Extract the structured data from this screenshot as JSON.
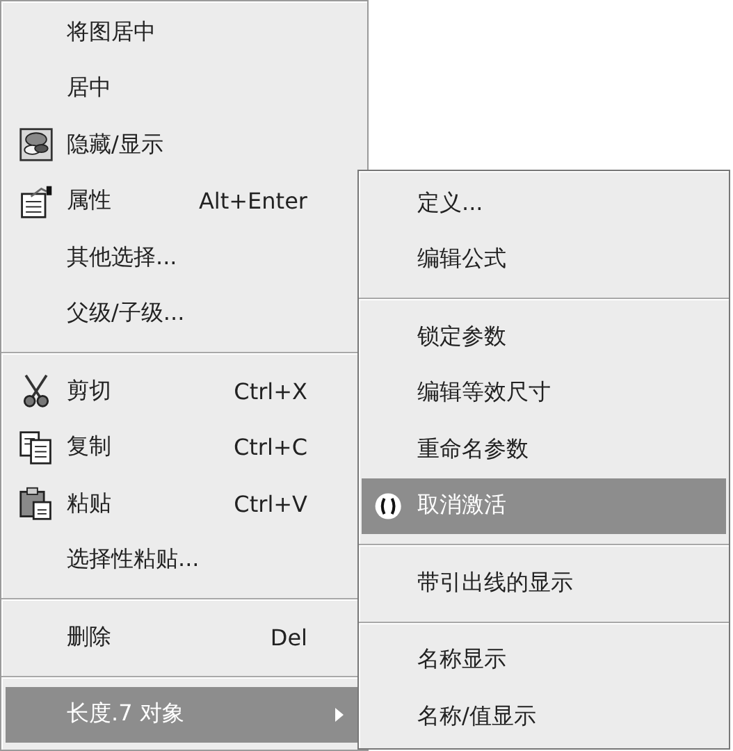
{
  "context_menu": {
    "items": [
      {
        "kind": "command",
        "label": "将图居中",
        "selected": false
      },
      {
        "kind": "command",
        "label": "居中",
        "selected": false
      },
      {
        "kind": "command",
        "label": "隐藏/显示",
        "selected": false
      },
      {
        "kind": "command",
        "label": "属性",
        "shortcut": "Alt+Enter",
        "selected": false
      },
      {
        "kind": "command",
        "label": "其他选择...",
        "selected": false
      },
      {
        "kind": "command",
        "label": "父级/子级...",
        "selected": false
      },
      {
        "kind": "separator"
      },
      {
        "kind": "command",
        "label": "剪切",
        "shortcut": "Ctrl+X",
        "selected": false
      },
      {
        "kind": "command",
        "label": "复制",
        "shortcut": "Ctrl+C",
        "selected": false
      },
      {
        "kind": "command",
        "label": "粘贴",
        "shortcut": "Ctrl+V",
        "selected": false
      },
      {
        "kind": "command",
        "label": "选择性粘贴...",
        "selected": false
      },
      {
        "kind": "separator"
      },
      {
        "kind": "command",
        "label": "删除",
        "shortcut": "Del",
        "selected": false
      },
      {
        "kind": "separator"
      },
      {
        "kind": "command",
        "label": "长度.7 对象",
        "selected": true,
        "has_submenu": true
      }
    ]
  },
  "submenu": {
    "items": [
      {
        "kind": "command",
        "label": "定义...",
        "selected": false
      },
      {
        "kind": "command",
        "label": "编辑公式",
        "selected": false
      },
      {
        "kind": "separator"
      },
      {
        "kind": "command",
        "label": "锁定参数",
        "selected": false
      },
      {
        "kind": "command",
        "label": "编辑等效尺寸",
        "selected": false
      },
      {
        "kind": "command",
        "label": "重命名参数",
        "selected": false
      },
      {
        "kind": "command",
        "label": "取消激活",
        "selected": true
      },
      {
        "kind": "separator"
      },
      {
        "kind": "command",
        "label": "带引出线的显示",
        "selected": false
      },
      {
        "kind": "separator"
      },
      {
        "kind": "command",
        "label": "名称显示",
        "selected": false
      },
      {
        "kind": "command",
        "label": "名称/值显示",
        "selected": false
      }
    ]
  }
}
